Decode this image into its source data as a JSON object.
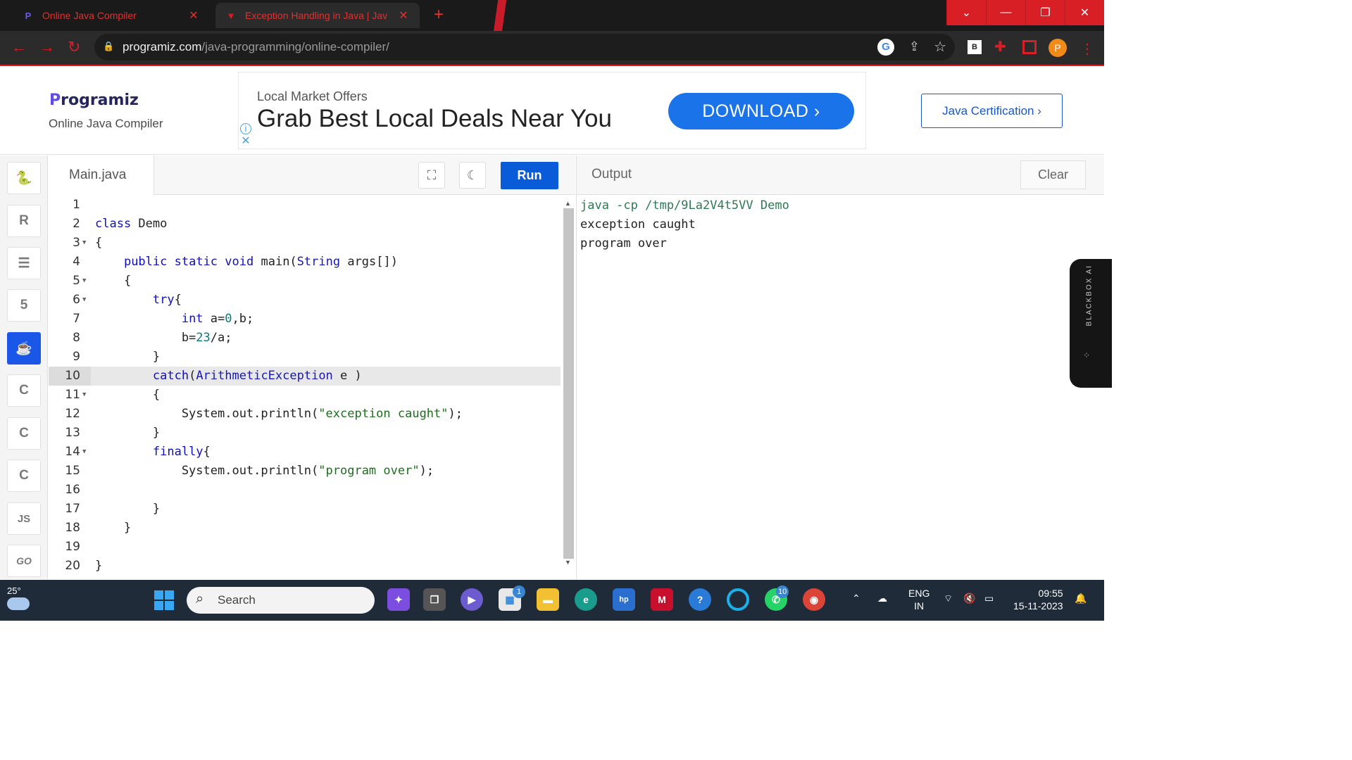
{
  "browser": {
    "tabs": [
      {
        "title": "Online Java Compiler",
        "close": "✕"
      },
      {
        "title": "Exception Handling in Java | Jav",
        "close": "✕"
      }
    ],
    "new_tab": "+",
    "window_buttons": [
      "⌄",
      "—",
      "❐",
      "✕"
    ],
    "url_domain": "programiz.com",
    "url_path": "/java-programming/online-compiler/",
    "profile_initial": "P",
    "ext_b": "B"
  },
  "header": {
    "logo_p": "P",
    "logo_rest": "rogramiz",
    "subtitle": "Online Java Compiler",
    "ad_small": "Local Market Offers",
    "ad_big": "Grab Best Local Deals Near You",
    "ad_button": "DOWNLOAD  ›",
    "cert_button": "Java Certification ›"
  },
  "sidebar": [
    "python",
    "r",
    "sql",
    "html",
    "java",
    "c",
    "cpp",
    "csharp",
    "JS",
    "GO"
  ],
  "editor": {
    "file_tab": "Main.java",
    "run_label": "Run",
    "highlight_line": 10
  },
  "code_lines": [
    "",
    "class Demo",
    "{",
    "    public static void main(String args[])",
    "    {",
    "        try{",
    "            int a=0,b;",
    "            b=23/a;",
    "        }",
    "        catch(ArithmeticException e )",
    "        {",
    "            System.out.println(\"exception caught\");",
    "        }",
    "        finally{",
    "            System.out.println(\"program over\");",
    "",
    "        }",
    "    }",
    "",
    "}"
  ],
  "output": {
    "label": "Output",
    "clear_label": "Clear",
    "lines": [
      "java -cp /tmp/9La2V4t5VV Demo",
      "exception caught",
      "program over"
    ]
  },
  "blackbox_label": "BLACKBOX AI",
  "taskbar": {
    "temperature": "25°",
    "search_placeholder": "Search",
    "badge_store": "1",
    "badge_whatsapp": "10",
    "language_line1": "ENG",
    "language_line2": "IN",
    "time": "09:55",
    "date": "15-11-2023"
  }
}
